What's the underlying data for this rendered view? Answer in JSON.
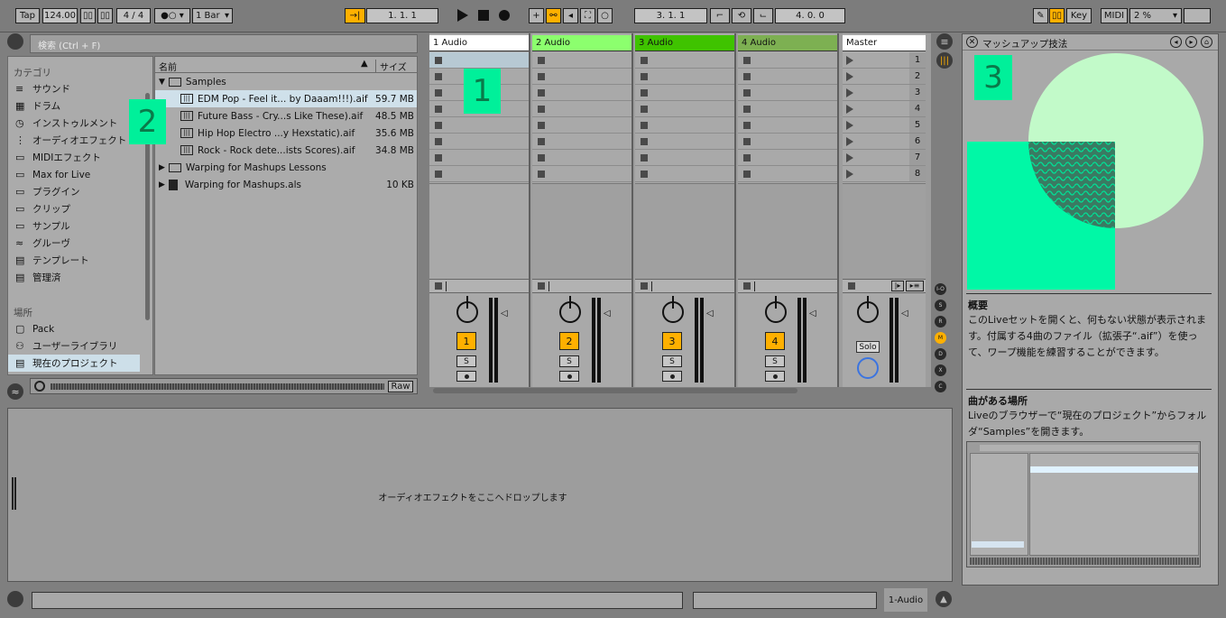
{
  "transport": {
    "tap": "Tap",
    "tempo": "124.00",
    "signature": "4 / 4",
    "quantize": "1 Bar",
    "position": "1.   1.   1",
    "loop_start": "3.   1.   1",
    "loop_length": "4.   0.   0",
    "key": "Key",
    "midi": "MIDI",
    "cpu": "2 %"
  },
  "browser": {
    "search_placeholder": "検索 (Ctrl + F)",
    "categories_header": "カテゴリ",
    "categories": [
      "サウンド",
      "ドラム",
      "インストゥルメント",
      "オーディオエフェクト",
      "MIDIエフェクト",
      "Max for Live",
      "プラグイン",
      "クリップ",
      "サンプル",
      "グルーヴ",
      "テンプレート",
      "管理済"
    ],
    "places_header": "場所",
    "places": [
      "Pack",
      "ユーザーライブラリ",
      "現在のプロジェクト"
    ],
    "col_name": "名前",
    "col_size": "サイズ",
    "items": [
      {
        "name": "Samples",
        "size": "",
        "type": "folder-open",
        "indent": 0
      },
      {
        "name": "EDM Pop - Feel it... by Daaam!!!).aif",
        "size": "59.7 MB",
        "type": "audio",
        "indent": 1,
        "selected": true
      },
      {
        "name": "Future Bass - Cry...s Like These).aif",
        "size": "48.5 MB",
        "type": "audio",
        "indent": 1
      },
      {
        "name": "Hip Hop Electro ...y Hexstatic).aif",
        "size": "35.6 MB",
        "type": "audio",
        "indent": 1
      },
      {
        "name": "Rock - Rock dete...ists Scores).aif",
        "size": "34.8 MB",
        "type": "audio",
        "indent": 1
      },
      {
        "name": "Warping for Mashups Lessons",
        "size": "",
        "type": "folder",
        "indent": 0
      },
      {
        "name": "Warping for Mashups.als",
        "size": "10 KB",
        "type": "set",
        "indent": 0
      }
    ],
    "raw": "Raw"
  },
  "tracks": [
    {
      "name": "1 Audio",
      "num": "1",
      "color": "#ffffff"
    },
    {
      "name": "2 Audio",
      "num": "2",
      "color": "#8cff6e"
    },
    {
      "name": "3 Audio",
      "num": "3",
      "color": "#3fc300"
    },
    {
      "name": "4 Audio",
      "num": "4",
      "color": "#7db052"
    }
  ],
  "master": {
    "name": "Master",
    "scenes": [
      "1",
      "2",
      "3",
      "4",
      "5",
      "6",
      "7",
      "8"
    ],
    "solo": "Solo"
  },
  "solo_label": "S",
  "markers": {
    "m1": "1",
    "m2": "2",
    "m3": "3"
  },
  "device": {
    "drop_text": "オーディオエフェクトをここへドロップします",
    "track_label": "1-Audio"
  },
  "lesson": {
    "title": "マッシュアップ技法",
    "h1": "概要",
    "p1": "このLiveセットを開くと、何もない状態が表示されます。付属する4曲のファイル（拡張子“.aif”）を使って、ワープ機能を練習することができます。",
    "h2": "曲がある場所",
    "p2": "Liveのブラウザーで“現在のプロジェクト”からフォルダ“Samples”を開きます。"
  },
  "side_buttons": [
    "I-O",
    "S",
    "R",
    "M",
    "D",
    "X",
    "C"
  ]
}
